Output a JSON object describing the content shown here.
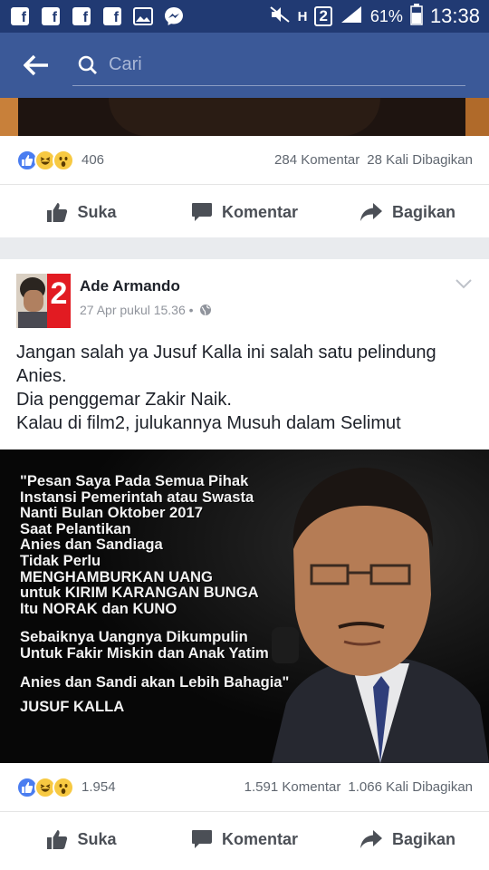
{
  "status_bar": {
    "battery": "61%",
    "time": "13:38",
    "network": "H",
    "sim": "2"
  },
  "top_bar": {
    "search_placeholder": "Cari"
  },
  "prev_post": {
    "reaction_count": "406",
    "comments": "284 Komentar",
    "shares": "28 Kali Dibagikan"
  },
  "actions": {
    "like": "Suka",
    "comment": "Komentar",
    "share": "Bagikan"
  },
  "post": {
    "author": "Ade Armando",
    "timestamp": "27 Apr pukul 15.36 •",
    "avatar_badge": "2",
    "text_lines": [
      "Jangan salah ya  Jusuf Kalla ini salah satu pelindung",
      "Anies.",
      "Dia penggemar Zakir Naik.",
      "Kalau di film2,  julukannya Musuh dalam Selimut"
    ],
    "image_quote": {
      "block1": [
        "\"Pesan Saya Pada Semua Pihak",
        "Instansi Pemerintah atau Swasta",
        "Nanti  Bulan Oktober 2017",
        "Saat Pelantikan",
        "Anies dan Sandiaga",
        "Tidak Perlu",
        "MENGHAMBURKAN UANG",
        "untuk KIRIM KARANGAN BUNGA",
        "Itu NORAK dan KUNO"
      ],
      "block2": [
        "Sebaiknya Uangnya Dikumpulin",
        "Untuk Fakir Miskin dan Anak Yatim"
      ],
      "block3": "Anies dan Sandi akan Lebih Bahagia\"",
      "signature": "JUSUF KALLA"
    },
    "reaction_count": "1.954",
    "comments": "1.591 Komentar",
    "shares": "1.066 Kali Dibagikan"
  },
  "colors": {
    "status_bar": "#213a73",
    "top_bar": "#3b5998",
    "like_blue": "#4a7df0",
    "emoji_yellow": "#f7c942"
  }
}
